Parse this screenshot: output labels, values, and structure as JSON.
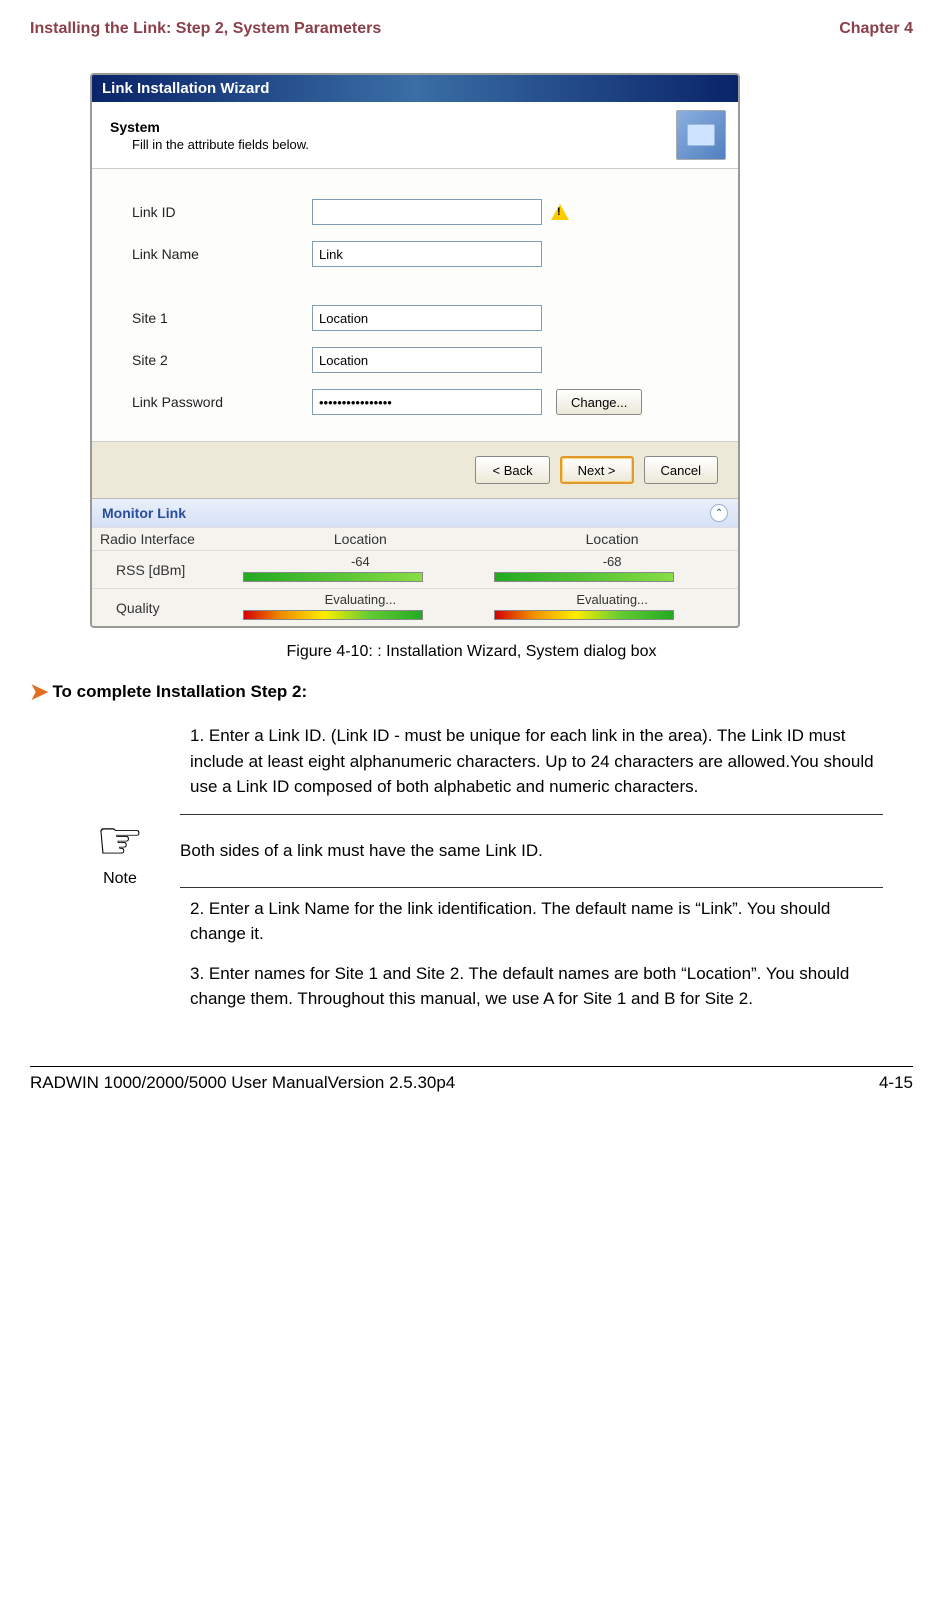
{
  "header": {
    "left": "Installing the Link: Step 2, System Parameters",
    "right": "Chapter 4"
  },
  "wizard": {
    "titlebar": "Link Installation Wizard",
    "header_title": "System",
    "header_sub": "Fill in the attribute fields below.",
    "fields": {
      "link_id": {
        "label": "Link ID",
        "value": ""
      },
      "link_name": {
        "label": "Link Name",
        "value": "Link"
      },
      "site1": {
        "label": "Site 1",
        "value": "Location"
      },
      "site2": {
        "label": "Site 2",
        "value": "Location"
      },
      "link_password": {
        "label": "Link Password",
        "value": "••••••••••••••••"
      },
      "change_button": "Change..."
    },
    "buttons": {
      "back": "< Back",
      "next": "Next >",
      "cancel": "Cancel"
    },
    "monitor": {
      "title": "Monitor Link",
      "col_radio": "Radio Interface",
      "col_loc1": "Location",
      "col_loc2": "Location",
      "row_rss_label": "RSS [dBm]",
      "rss1": "-64",
      "rss2": "-68",
      "row_quality_label": "Quality",
      "quality1": "Evaluating...",
      "quality2": "Evaluating..."
    }
  },
  "figure_caption": "Figure 4-10: : Installation Wizard, System dialog box",
  "proc_heading": "To complete Installation Step 2:",
  "body": {
    "step1": "1. Enter a Link ID. (Link ID - must be unique for each link in the area). The Link ID must include at least eight alphanumeric characters. Up to 24 characters are allowed.You should use a Link ID composed of both alphabetic and numeric characters.",
    "note_label": "Note",
    "note_text": "Both sides of a link must have the same Link ID.",
    "step2": "2. Enter a Link Name for the link identification. The default name is “Link”. You should change it.",
    "step3": "3. Enter names for Site 1 and Site 2. The default names are both “Location”. You should change them. Throughout this manual, we use A for Site 1 and B for Site 2."
  },
  "footer": {
    "left": "RADWIN 1000/2000/5000 User ManualVersion  2.5.30p4",
    "right": "4-15"
  }
}
